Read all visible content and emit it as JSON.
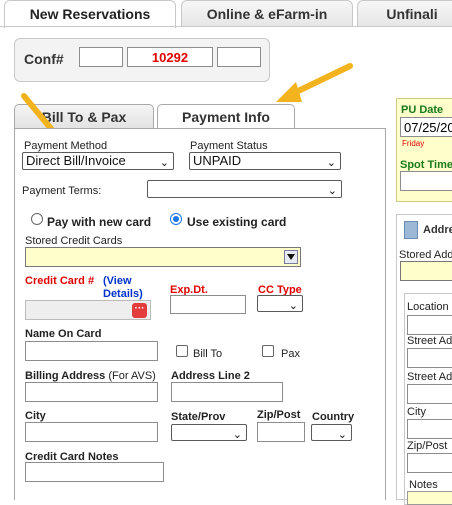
{
  "tabs": [
    {
      "label": "New Reservations"
    },
    {
      "label": "Online & eFarm-in"
    },
    {
      "label": "Unfinali"
    }
  ],
  "conf": {
    "label": "Conf#",
    "value": "10292"
  },
  "subtabs": [
    {
      "label": "Bill To & Pax"
    },
    {
      "label": "Payment Info"
    }
  ],
  "payment": {
    "method_label": "Payment Method",
    "method_value": "Direct Bill/Invoice",
    "status_label": "Payment Status",
    "status_value": "UNPAID",
    "terms_label": "Payment Terms:",
    "terms_value": "",
    "radio_new": "Pay with new card",
    "radio_existing": "Use existing card",
    "stored_cards_label": "Stored Credit Cards",
    "cc_label": "Credit Card #",
    "view_details": "(View Details)",
    "exp_label": "Exp.Dt.",
    "cctype_label": "CC Type",
    "name_label": "Name On Card",
    "billto_label": "Bill To",
    "pax_label": "Pax",
    "billing_label": "Billing Address",
    "billing_sub": "(For AVS)",
    "addr2_label": "Address Line 2",
    "city_label": "City",
    "state_label": "State/Prov",
    "zip_label": "Zip/Post",
    "country_label": "Country",
    "notes_label": "Credit Card Notes"
  },
  "right": {
    "pu_date_label": "PU Date",
    "pu_date_value": "07/25/20",
    "day": "Friday",
    "spot_time_label": "Spot Time",
    "address_header": "Addre",
    "stored_addr_label": "Stored Addr",
    "location_label": "Location I",
    "street1_label": "Street Ad",
    "street2_label": "Street Ad",
    "city_label": "City",
    "zip_label": "Zip/Post",
    "notes_label": "Notes"
  },
  "colors": {
    "accent_yellow": "#ffffcc",
    "required_red": "#e00000",
    "link_blue": "#0033cc",
    "arrow": "#f3b31c"
  }
}
